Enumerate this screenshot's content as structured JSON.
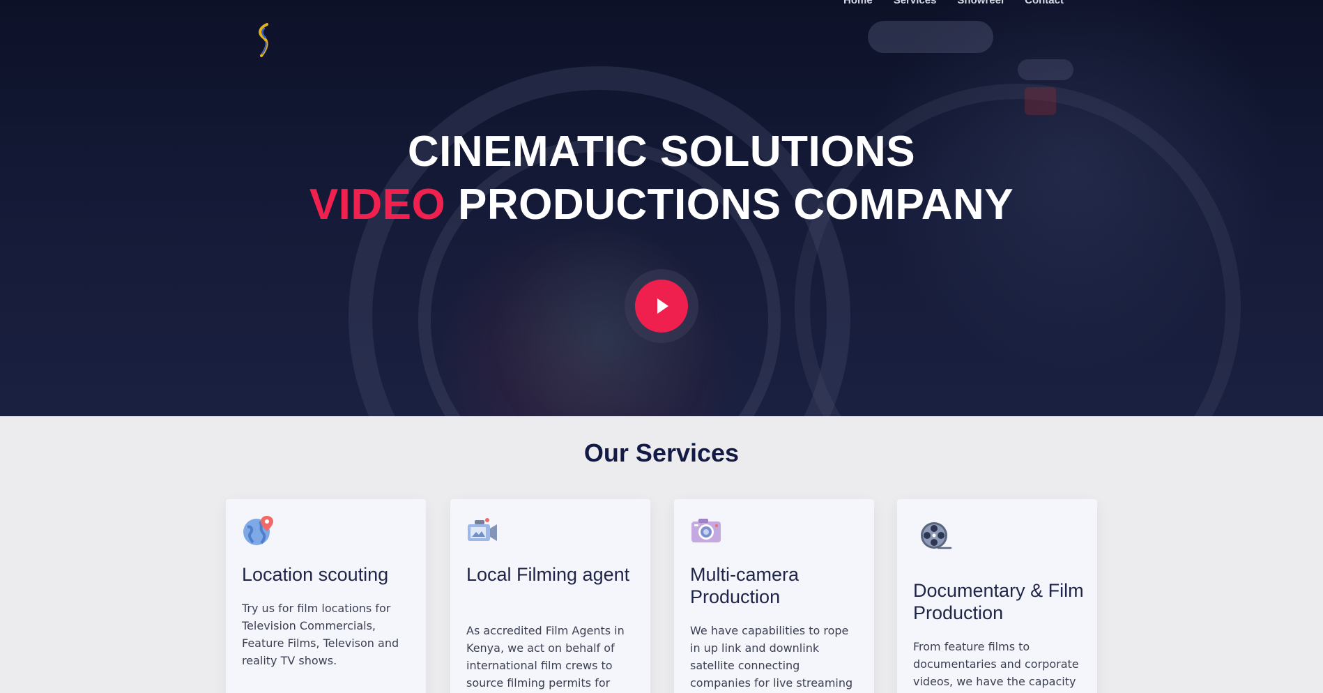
{
  "nav": {
    "items": [
      "Home",
      "Services",
      "Showreel",
      "Contact"
    ]
  },
  "logo": {
    "icon": "logo-s-icon"
  },
  "hero": {
    "title_line1": "CINEMATIC SOLUTIONS",
    "title_accent": "VIDEO",
    "title_line2_rest": " PRODUCTIONS COMPANY",
    "play_icon": "play-icon"
  },
  "services": {
    "title": "Our Services",
    "cards": [
      {
        "icon": "globe-pin-icon",
        "title": "Location scouting",
        "text": "Try us for film locations for Television Commercials, Feature Films, Televison and reality TV shows."
      },
      {
        "icon": "video-camera-icon",
        "title": "Local Filming agent",
        "text": "As accredited Film Agents in Kenya, we act on behalf of international film crews to source filming permits for their"
      },
      {
        "icon": "photo-camera-icon",
        "title": "Multi-camera Production",
        "text": "We have capabilities to rope in up link and downlink satellite connecting companies for live streaming across the world."
      },
      {
        "icon": "film-reel-icon",
        "title": "Documentary & Film Production",
        "text": "From feature films to documentaries and corporate videos, we have the capacity to"
      }
    ]
  },
  "colors": {
    "accent": "#f0214f",
    "hero_bg": "#0d1128",
    "services_title": "#131a44",
    "card_bg": "#f5f6fb"
  }
}
